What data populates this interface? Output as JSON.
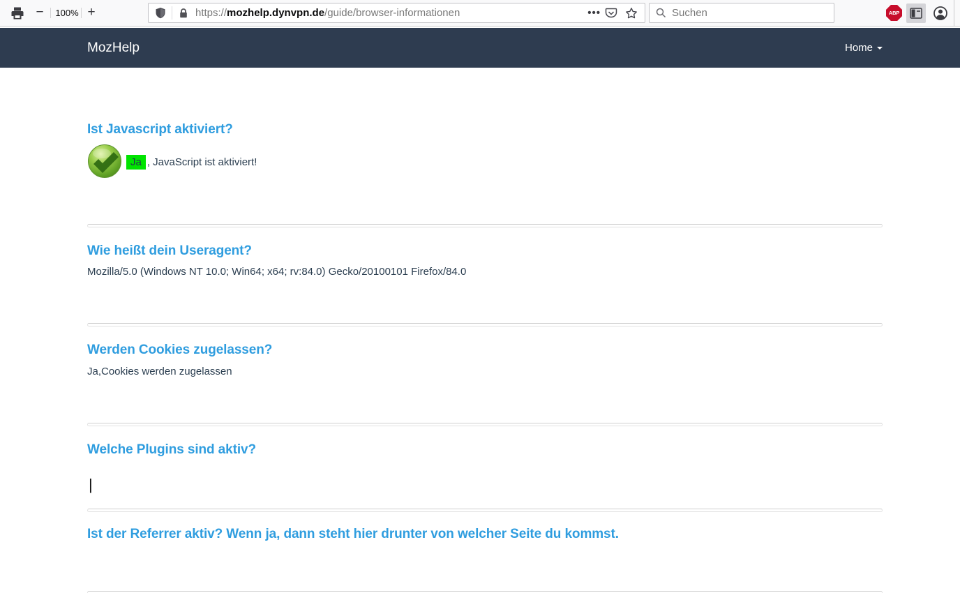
{
  "chrome": {
    "zoom_out_label": "−",
    "zoom_level": "100%",
    "zoom_in_label": "+",
    "url_scheme": "https://",
    "url_domain": "mozhelp.dynvpn.de",
    "url_path": "/guide/browser-informationen",
    "page_actions_label": "•••",
    "search_placeholder": "Suchen",
    "abp_badge": "ABP"
  },
  "site": {
    "brand": "MozHelp",
    "nav_home": "Home"
  },
  "sections": [
    {
      "heading": "Ist Javascript aktiviert?",
      "badge": "Ja",
      "text": ", JavaScript ist aktiviert!"
    },
    {
      "heading": "Wie heißt dein Useragent?",
      "text": "Mozilla/5.0 (Windows NT 10.0; Win64; x64; rv:84.0) Gecko/20100101 Firefox/84.0"
    },
    {
      "heading": "Werden Cookies zugelassen?",
      "text": "Ja,Cookies werden zugelassen"
    },
    {
      "heading": "Welche Plugins sind aktiv?",
      "cursor": "|"
    },
    {
      "heading": "Ist der Referrer aktiv? Wenn ja, dann steht hier drunter von welcher Seite du kommst."
    }
  ],
  "colors": {
    "navbar_bg": "#2e3c50",
    "heading_blue": "#2f9ddf",
    "body_text": "#2b3e50",
    "badge_green": "#00e400",
    "abp_red": "#c70d2b",
    "check_green": "#6aaa2d"
  }
}
